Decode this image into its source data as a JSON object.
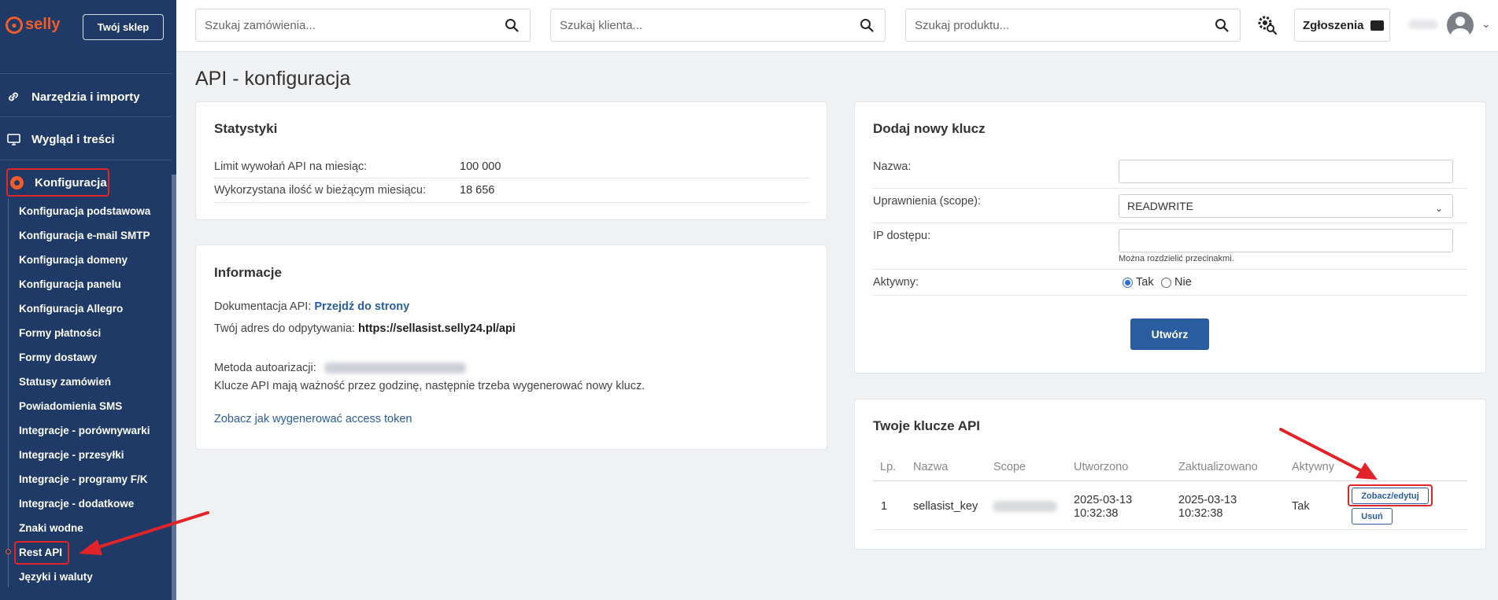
{
  "sidebar": {
    "logo_text": "selly",
    "shop_button": "Twój sklep",
    "main_items": [
      {
        "label": "Narzędzia i importy",
        "icon": "link-icon"
      },
      {
        "label": "Wygląd i treści",
        "icon": "monitor-icon"
      }
    ],
    "active_item": {
      "label": "Konfiguracja",
      "icon": "gear-icon"
    },
    "sub_items": [
      "Konfiguracja podstawowa",
      "Konfiguracja e-mail SMTP",
      "Konfiguracja domeny",
      "Konfiguracja panelu",
      "Konfiguracja Allegro",
      "Formy płatności",
      "Formy dostawy",
      "Statusy zamówień",
      "Powiadomienia SMS",
      "Integracje - porównywarki",
      "Integracje - przesyłki",
      "Integracje - programy F/K",
      "Integracje - dodatkowe",
      "Znaki wodne",
      "Rest API",
      "Języki i waluty"
    ]
  },
  "topbar": {
    "search_orders_placeholder": "Szukaj zamówienia...",
    "search_clients_placeholder": "Szukaj klienta...",
    "search_products_placeholder": "Szukaj produktu...",
    "tickets_label": "Zgłoszenia"
  },
  "page": {
    "title": "API - konfiguracja"
  },
  "stats": {
    "title": "Statystyki",
    "rows": [
      {
        "label": "Limit wywołań API na miesiąc:",
        "value": "100 000"
      },
      {
        "label": "Wykorzystana ilość w bieżącym miesiącu:",
        "value": "18 656"
      }
    ]
  },
  "info": {
    "title": "Informacje",
    "doc_label": "Dokumentacja API:",
    "doc_link": "Przejdź do strony",
    "address_label": "Twój adres do odpytywania:",
    "address_value": "https://sellasist.selly24.pl/api",
    "auth_label": "Metoda autoarizacji:",
    "validity_text": "Klucze API mają ważność przez godzinę, następnie trzeba wygenerować nowy klucz.",
    "token_link": "Zobacz jak wygenerować access token"
  },
  "new_key": {
    "title": "Dodaj nowy klucz",
    "name_label": "Nazwa:",
    "name_value": "",
    "scope_label": "Uprawnienia (scope):",
    "scope_value": "READWRITE",
    "ip_label": "IP dostępu:",
    "ip_value": "",
    "ip_hint": "Można rozdzielić przecinakmi.",
    "active_label": "Aktywny:",
    "active_yes": "Tak",
    "active_no": "Nie",
    "active_selected": "Tak",
    "create_button": "Utwórz"
  },
  "keys": {
    "title": "Twoje klucze API",
    "columns": [
      "Lp.",
      "Nazwa",
      "Scope",
      "Utworzono",
      "Zaktualizowano",
      "Aktywny"
    ],
    "rows": [
      {
        "lp": "1",
        "name": "sellasist_key",
        "created_date": "2025-03-13",
        "created_time": "10:32:38",
        "updated_date": "2025-03-13",
        "updated_time": "10:32:38",
        "active": "Tak",
        "view_button": "Zobacz/edytuj",
        "delete_button": "Usuń"
      }
    ]
  },
  "colors": {
    "sidebar_bg": "#1f3a66",
    "accent_orange": "#f25c2a",
    "primary_blue": "#2a5d9f",
    "annotation_red": "#e2232a"
  }
}
